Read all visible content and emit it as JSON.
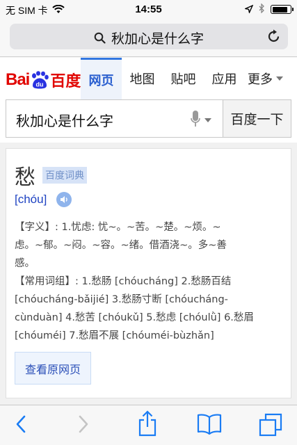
{
  "status_bar": {
    "carrier": "无 SIM 卡",
    "time": "14:55",
    "battery_level": 0.85
  },
  "url_bar": {
    "text": "秋加心是什么字"
  },
  "baidu": {
    "logo_bai": "Bai",
    "logo_du_mark": "du",
    "logo_text": "百度",
    "nav": [
      "网页",
      "地图",
      "贴吧",
      "应用",
      "更多"
    ],
    "active_nav": "网页",
    "search_value": "秋加心是什么字",
    "search_button": "百度一下"
  },
  "result": {
    "word": "愁",
    "badge": "百度词典",
    "pinyin": "[chóu]",
    "definition_lines": [
      "【字义】: 1.忧虑: 忧~。~苦。~楚。~烦。~",
      "虑。~郁。~闷。~容。~绪。借酒浇~。多~善",
      "感。",
      "【常用词组】: 1.愁肠 [chóucháng] 2.愁肠百结",
      "[chóucháng-bǎijié] 3.愁肠寸断 [chóucháng-",
      "cùnduàn] 4.愁苦 [chóukǔ] 5.愁虑 [chóulǜ] 6.愁眉",
      "[chóuméi] 7.愁眉不展 [chóuméi-bùzhǎn]"
    ],
    "source_button": "查看原网页"
  },
  "icons": {
    "signal": "wifi-icon",
    "location": "location-arrow-icon",
    "bluetooth": "bluetooth-icon",
    "battery": "battery-icon",
    "search": "search-icon",
    "reload": "reload-icon",
    "mic": "microphone-icon",
    "speaker": "speaker-icon",
    "back": "back-chevron-icon",
    "forward": "forward-chevron-icon",
    "share": "share-icon",
    "bookmarks": "bookmarks-icon",
    "tabs": "tabs-icon"
  },
  "colors": {
    "baidu_red": "#e10602",
    "baidu_blue": "#2a5fcf",
    "ios_blue": "#1a7cf4"
  }
}
